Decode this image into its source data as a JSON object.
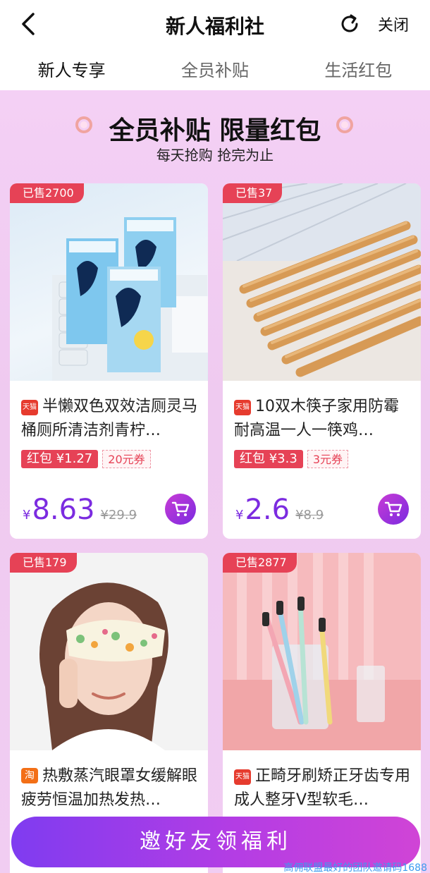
{
  "header": {
    "title": "新人福利社",
    "close_label": "关闭"
  },
  "tabs": [
    {
      "label": "新人专享",
      "active": true
    },
    {
      "label": "全员补贴",
      "active": false
    },
    {
      "label": "生活红包",
      "active": false
    }
  ],
  "banner": {
    "title": "全员补贴 限量红包",
    "subtitle": "每天抢购 抢完为止"
  },
  "products": [
    {
      "sold": "已售2700",
      "shop": "天猫",
      "title": "半懒双色双效洁厕灵马桶厕所清洁剂青柠…",
      "red_packet": "红包 ¥1.27",
      "coupon": "20元券",
      "price_symbol": "¥",
      "price": "8.63",
      "original_price": "¥29.9"
    },
    {
      "sold": "已售37",
      "shop": "天猫",
      "title": "10双木筷子家用防霉耐高温一人一筷鸡…",
      "red_packet": "红包 ¥3.3",
      "coupon": "3元券",
      "price_symbol": "¥",
      "price": "2.6",
      "original_price": "¥8.9"
    },
    {
      "sold": "已售179",
      "shop": "淘",
      "title": "热敷蒸汽眼罩女缓解眼疲劳恒温加热发热…"
    },
    {
      "sold": "已售2877",
      "shop": "天猫",
      "title": "正畸牙刷矫正牙齿专用成人整牙V型软毛…"
    }
  ],
  "cta": {
    "label": "邀好友领福利"
  },
  "watermark": "高佣联盟最好的团队邀请码1688"
}
